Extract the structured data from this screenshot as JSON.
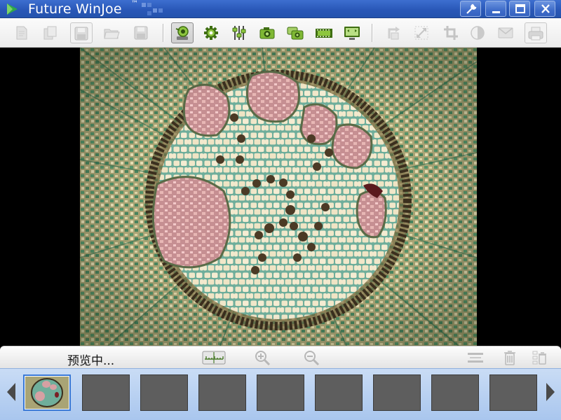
{
  "window": {
    "title": "Future WinJoe",
    "trademark": "™",
    "buttons": [
      "tools-icon",
      "minimize-icon",
      "maximize-icon",
      "close-icon"
    ]
  },
  "toolbar": {
    "items": [
      {
        "icon": "new-document-icon",
        "state": "disabled"
      },
      {
        "icon": "copy-document-icon",
        "state": "disabled"
      },
      {
        "icon": "save-as-icon",
        "state": "disabled"
      },
      {
        "icon": "open-folder-icon",
        "state": "disabled"
      },
      {
        "icon": "save-icon",
        "state": "disabled"
      },
      {
        "icon": "camera-preview-icon",
        "state": "active"
      },
      {
        "icon": "settings-gear-icon",
        "state": "enabled"
      },
      {
        "icon": "adjustment-sliders-icon",
        "state": "enabled"
      },
      {
        "icon": "camera-capture-icon",
        "state": "enabled"
      },
      {
        "icon": "multi-capture-icon",
        "state": "enabled"
      },
      {
        "icon": "video-film-icon",
        "state": "enabled"
      },
      {
        "icon": "screen-monitor-icon",
        "state": "enabled"
      },
      {
        "icon": "rotate-icon",
        "state": "disabled"
      },
      {
        "icon": "resize-icon",
        "state": "disabled"
      },
      {
        "icon": "crop-icon",
        "state": "disabled"
      },
      {
        "icon": "contrast-icon",
        "state": "disabled"
      },
      {
        "icon": "email-icon",
        "state": "disabled"
      },
      {
        "icon": "print-icon",
        "state": "disabled"
      }
    ]
  },
  "preview": {
    "image": "stained-plant-stem-cross-section"
  },
  "statusbar": {
    "status_text": "预览中...",
    "buttons": [
      "measure-ruler-icon",
      "zoom-in-icon",
      "zoom-out-icon",
      "fit-width-icon",
      "delete-icon",
      "delete-all-icon"
    ]
  },
  "thumbnails": {
    "count": 9,
    "selected_index": 0,
    "nav": [
      "left-arrow-icon",
      "right-arrow-icon"
    ]
  },
  "colors": {
    "titlebar": "#2a58b8",
    "toolbar": "#f2f2f2",
    "thumbstrip": "#b8d0f2",
    "selection": "#3a79d6"
  }
}
